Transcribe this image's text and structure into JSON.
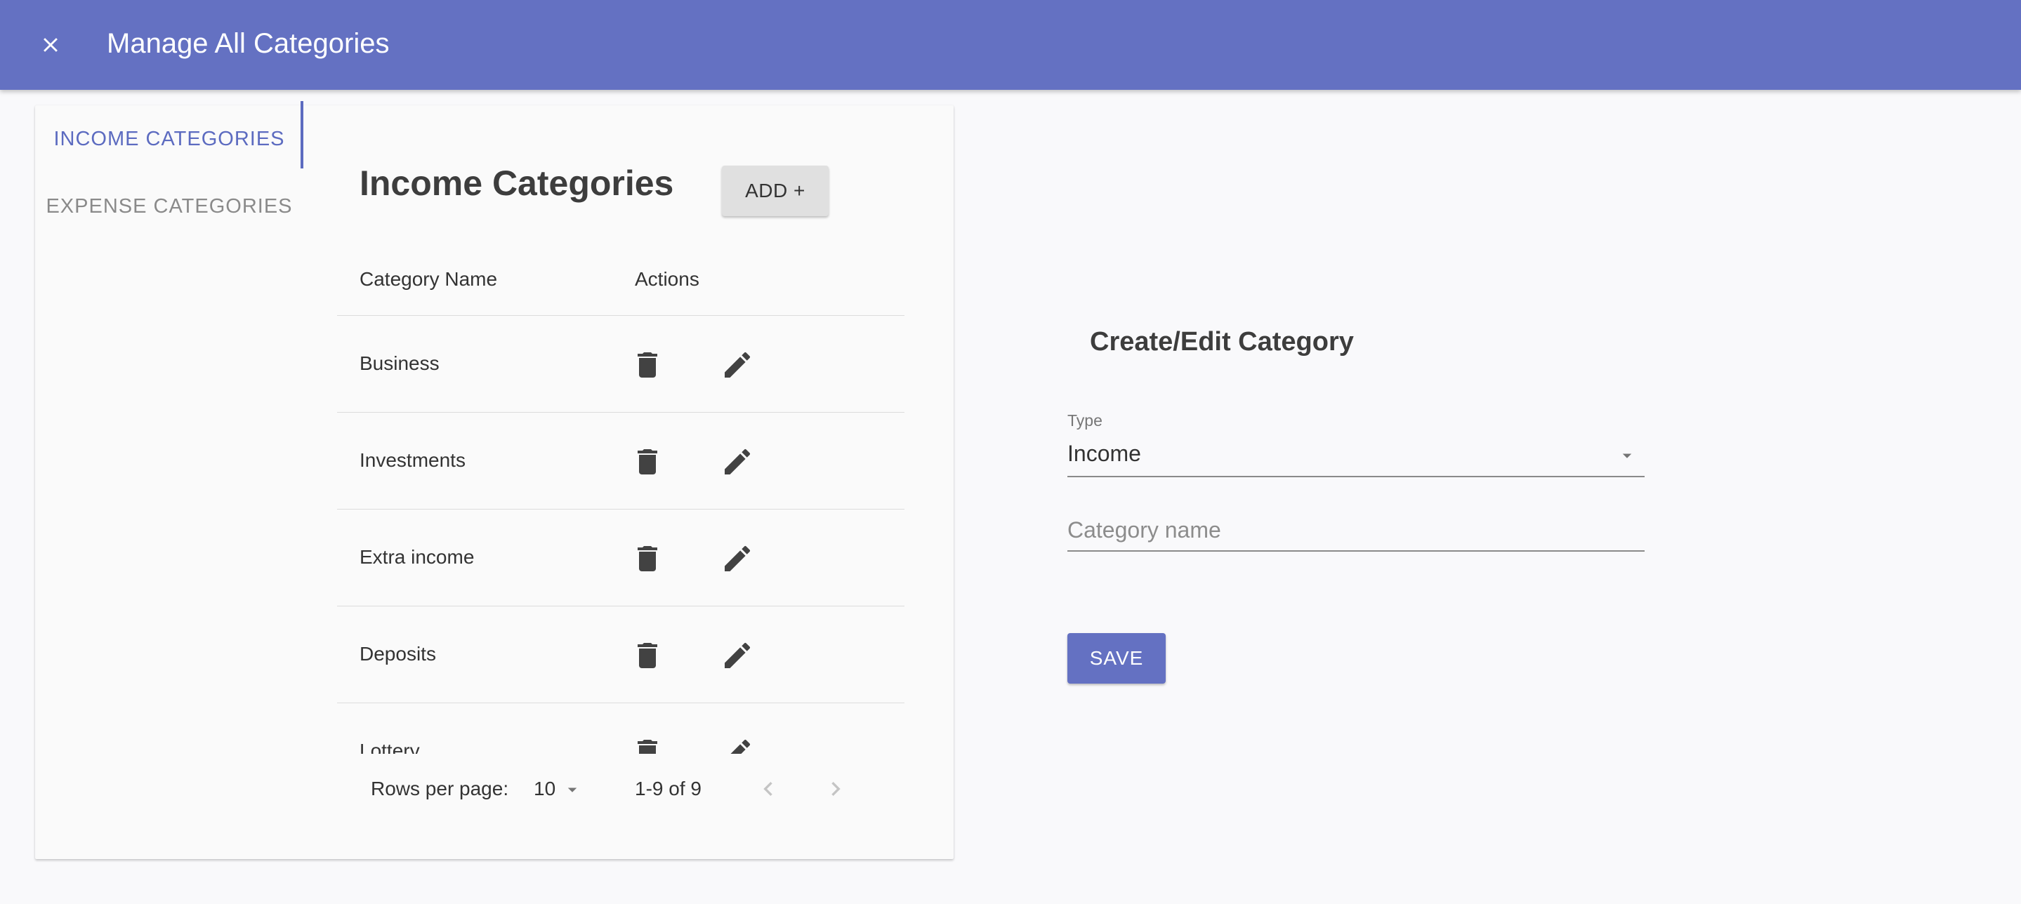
{
  "appbar": {
    "title": "Manage All Categories",
    "close_icon": "close-icon"
  },
  "tabs": [
    {
      "label": "INCOME CATEGORIES",
      "active": true
    },
    {
      "label": "EXPENSE CATEGORIES",
      "active": false
    }
  ],
  "list": {
    "title": "Income Categories",
    "add_label": "ADD +",
    "columns": [
      "Category Name",
      "Actions"
    ],
    "rows": [
      {
        "name": "Business"
      },
      {
        "name": "Investments"
      },
      {
        "name": "Extra income"
      },
      {
        "name": "Deposits"
      },
      {
        "name": "Lottery"
      }
    ],
    "row_icons": [
      "delete-icon",
      "edit-icon"
    ]
  },
  "pagination": {
    "rows_per_page_label": "Rows per page:",
    "rows_per_page_value": "10",
    "range": "1-9 of 9"
  },
  "form": {
    "title": "Create/Edit Category",
    "type_label": "Type",
    "type_value": "Income",
    "name_placeholder": "Category name",
    "name_value": "",
    "save_label": "SAVE"
  },
  "colors": {
    "primary": "#6471c2",
    "tab_active": "#5c6bc0",
    "text_dark": "#333333",
    "text_muted": "#8a8a8a"
  }
}
